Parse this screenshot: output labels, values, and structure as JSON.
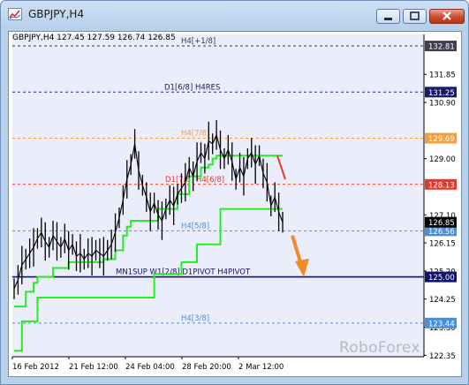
{
  "window": {
    "title": "GBPJPY,H4"
  },
  "header": {
    "ohlc": "GBPJPY,H4  127.45 127.59 126.74 126.85"
  },
  "watermark": "RoboForex",
  "colors": {
    "background": "#ecedfb",
    "price_line": "#000000",
    "level_line": "#22ee22",
    "forecast_arrow": "#f28a2c",
    "trend_segment": "#e8382a",
    "pivot_line": "#101070"
  },
  "chart_data": {
    "type": "line",
    "symbol": "GBPJPY",
    "timeframe": "H4",
    "ylim": [
      122.3,
      133.2
    ],
    "x_tick_labels": [
      "16 Feb 2012",
      "21 Feb 12:00",
      "24 Feb 04:00",
      "28 Feb 20:00",
      "2 Mar 12:00"
    ],
    "y_tick_labels": [
      "131.85",
      "130.90",
      "129.00",
      "127.10",
      "126.15",
      "125.20",
      "124.25",
      "123.30",
      "122.35"
    ],
    "levels": [
      {
        "label": "H4[+1/8]",
        "price": 132.81,
        "price_label": "132.81",
        "style": "dashed",
        "color": "#2a2a78",
        "label_color": "#3a3a3a",
        "tag_color": "#404050"
      },
      {
        "label": "D1[6/8] H4RES",
        "price": 131.25,
        "price_label": "131.25",
        "style": "dashed",
        "color": "#2a2a78",
        "label_color": "#1a1a5a",
        "tag_color": "#1a1a6a"
      },
      {
        "label": "H4[7/8]",
        "price": 129.69,
        "price_label": "129.69",
        "style": "dashed",
        "color": "#f0a040",
        "label_color": "#f0a040",
        "tag_color": "#f0a040"
      },
      {
        "label": "D1[7/8] H4[6/8]",
        "price": 128.13,
        "price_label": "128.13",
        "style": "dashed",
        "color": "#e8382a",
        "label_color": "#e8382a",
        "tag_color": "#e8382a"
      },
      {
        "label": "H4[5/8]",
        "price": 126.56,
        "price_label": "126.56",
        "style": "dashed",
        "color": "#4a90d9",
        "label_color": "#4a90d9",
        "tag_color": "#4a90d9"
      },
      {
        "label": "MN1SUP W1[2/8] D1PIVOT H4PIVOT",
        "price": 125.0,
        "price_label": "125.00",
        "style": "solid",
        "color": "#101070",
        "label_color": "#101060",
        "tag_color": "#101070"
      },
      {
        "label": "H4[3/8]",
        "price": 123.44,
        "price_label": "123.44",
        "style": "dashed",
        "color": "#4a90d9",
        "label_color": "#4a90d9",
        "tag_color": "#4a90d9"
      }
    ],
    "current_price": {
      "value": 126.85,
      "label": "126.85",
      "tag_color": "#000000"
    },
    "price_series": [
      124.6,
      124.9,
      125.4,
      125.6,
      125.8,
      126.0,
      126.3,
      126.5,
      126.2,
      126.0,
      126.4,
      126.2,
      126.0,
      126.3,
      125.9,
      126.1,
      125.7,
      125.8,
      125.6,
      125.8,
      125.7,
      125.9,
      125.8,
      125.7,
      125.9,
      126.1,
      126.5,
      127.0,
      127.6,
      128.3,
      128.8,
      129.5,
      128.6,
      128.1,
      127.7,
      127.2,
      127.5,
      127.1,
      126.9,
      127.3,
      127.6,
      127.4,
      127.8,
      128.0,
      128.2,
      128.7,
      128.4,
      128.9,
      129.2,
      129.0,
      129.6,
      129.5,
      129.8,
      129.3,
      129.0,
      129.3,
      128.9,
      128.3,
      128.7,
      128.4,
      129.0,
      129.2,
      128.8,
      129.1,
      128.5,
      128.2,
      127.4,
      127.7,
      127.2,
      126.85
    ],
    "support_staircase": [
      124.0,
      124.0,
      124.0,
      124.5,
      124.5,
      124.8,
      125.0,
      125.0,
      125.0,
      125.0,
      125.3,
      125.3,
      125.3,
      125.3,
      125.5,
      125.5,
      125.5,
      125.5,
      125.5,
      125.5,
      125.5,
      125.5,
      125.5,
      125.6,
      125.6,
      125.6,
      125.9,
      125.9,
      126.4,
      126.7,
      126.9,
      126.9,
      126.9,
      126.9,
      126.9,
      126.9,
      126.9,
      127.3,
      127.3,
      127.3,
      127.3,
      127.3,
      127.8,
      127.8,
      127.8,
      128.4,
      128.4,
      128.4,
      128.7,
      128.7,
      128.8,
      129.0,
      129.1,
      129.1,
      129.1,
      129.1,
      129.1,
      129.1,
      129.1,
      129.1,
      129.1,
      129.1,
      129.1,
      129.1,
      129.1,
      129.1,
      129.1,
      129.1,
      129.1,
      129.1
    ],
    "resistance_staircase": [
      122.5,
      122.5,
      123.5,
      123.5,
      123.5,
      123.5,
      124.3,
      124.3,
      124.3,
      124.3,
      124.3,
      124.3,
      124.3,
      124.3,
      124.3,
      124.3,
      124.3,
      124.3,
      124.3,
      124.3,
      124.3,
      124.3,
      124.3,
      124.3,
      124.3,
      124.3,
      124.3,
      124.3,
      124.3,
      124.3,
      124.3,
      124.3,
      124.3,
      124.3,
      124.3,
      124.3,
      125.1,
      125.1,
      125.1,
      125.1,
      125.1,
      125.1,
      125.1,
      125.5,
      125.5,
      125.5,
      125.5,
      126.1,
      126.1,
      126.1,
      126.1,
      126.1,
      126.1,
      127.3,
      127.3,
      127.3,
      127.3,
      127.3,
      127.3,
      127.3,
      127.3,
      127.3,
      127.3,
      127.3,
      127.3,
      127.3,
      127.3,
      127.3,
      127.3,
      127.3
    ],
    "forecast": {
      "direction": "down",
      "from_price": 126.4,
      "to_price": 125.05
    }
  }
}
